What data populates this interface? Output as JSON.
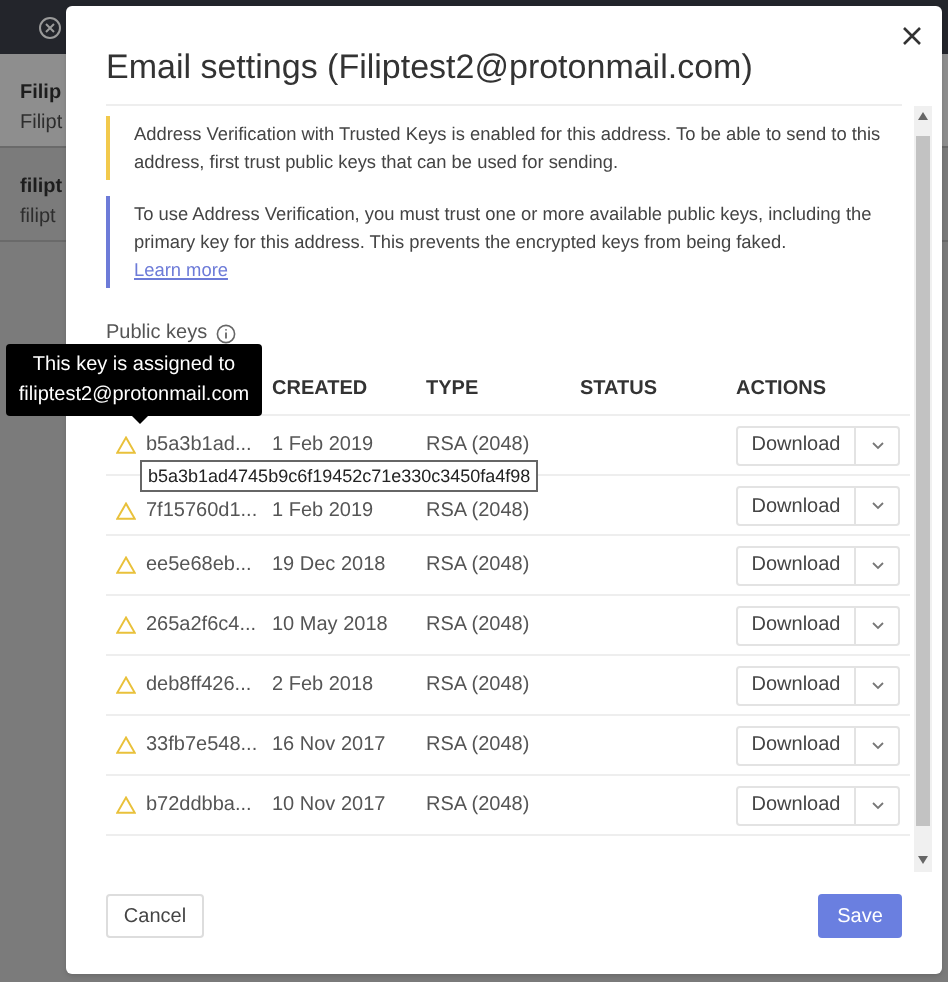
{
  "background": {
    "list": [
      {
        "title": "Filip",
        "subtitle": "Filipt",
        "selected": true
      },
      {
        "title": "filipt",
        "subtitle": "filipt",
        "selected": false
      }
    ]
  },
  "dialog": {
    "title": "Email settings (Filiptest2@protonmail.com)",
    "alerts": [
      {
        "text": "Address Verification with Trusted Keys is enabled for this address. To be able to send to this address, first trust public keys that can be used for sending.",
        "color": "#f2c94c"
      },
      {
        "text": "To use Address Verification, you must trust one or more available public keys, including the primary key for this address. This prevents the encrypted keys from being faked.",
        "link": "Learn more",
        "color": "#6d7bd8"
      }
    ],
    "section_label": "Public keys",
    "table": {
      "columns": [
        "CREATED",
        "TYPE",
        "STATUS",
        "ACTIONS"
      ],
      "rows": [
        {
          "fingerprint": "b5a3b1ad...",
          "created": "1 Feb 2019",
          "type": "RSA (2048)",
          "action": "Download"
        },
        {
          "fingerprint": "7f15760d1...",
          "created": "1 Feb 2019",
          "type": "RSA (2048)",
          "action": "Download"
        },
        {
          "fingerprint": "ee5e68eb...",
          "created": "19 Dec 2018",
          "type": "RSA (2048)",
          "action": "Download"
        },
        {
          "fingerprint": "265a2f6c4...",
          "created": "10 May 2018",
          "type": "RSA (2048)",
          "action": "Download"
        },
        {
          "fingerprint": "deb8ff426...",
          "created": "2 Feb 2018",
          "type": "RSA (2048)",
          "action": "Download"
        },
        {
          "fingerprint": "33fb7e548...",
          "created": "16 Nov 2017",
          "type": "RSA (2048)",
          "action": "Download"
        },
        {
          "fingerprint": "b72ddbba...",
          "created": "10 Nov 2017",
          "type": "RSA (2048)",
          "action": "Download"
        }
      ]
    },
    "tooltip": "This key is assigned to filiptest2@protonmail.com",
    "fingerprint_popup": "b5a3b1ad4745b9c6f19452c71e330c3450fa4f98",
    "buttons": {
      "cancel": "Cancel",
      "save": "Save"
    }
  }
}
